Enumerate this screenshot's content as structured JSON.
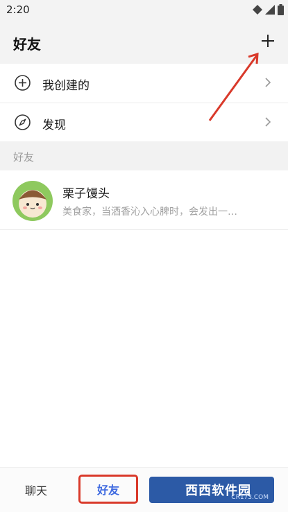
{
  "status_bar": {
    "time": "2:20"
  },
  "header": {
    "title": "好友"
  },
  "menu": {
    "items": [
      {
        "label": "我创建的",
        "icon": "plus-circle-icon"
      },
      {
        "label": "发现",
        "icon": "compass-icon"
      }
    ]
  },
  "section": {
    "label": "好友"
  },
  "friends": [
    {
      "name": "栗子馒头",
      "description": "美食家，当酒香沁入心脾时，会发出一…"
    }
  ],
  "tabs": [
    {
      "label": "聊天",
      "active": false
    },
    {
      "label": "好友",
      "active": true
    }
  ],
  "watermark": {
    "text": "西西软件园",
    "sub": "CR173.COM"
  },
  "colors": {
    "accent": "#3f6ae0",
    "annotation": "#d9392a"
  }
}
